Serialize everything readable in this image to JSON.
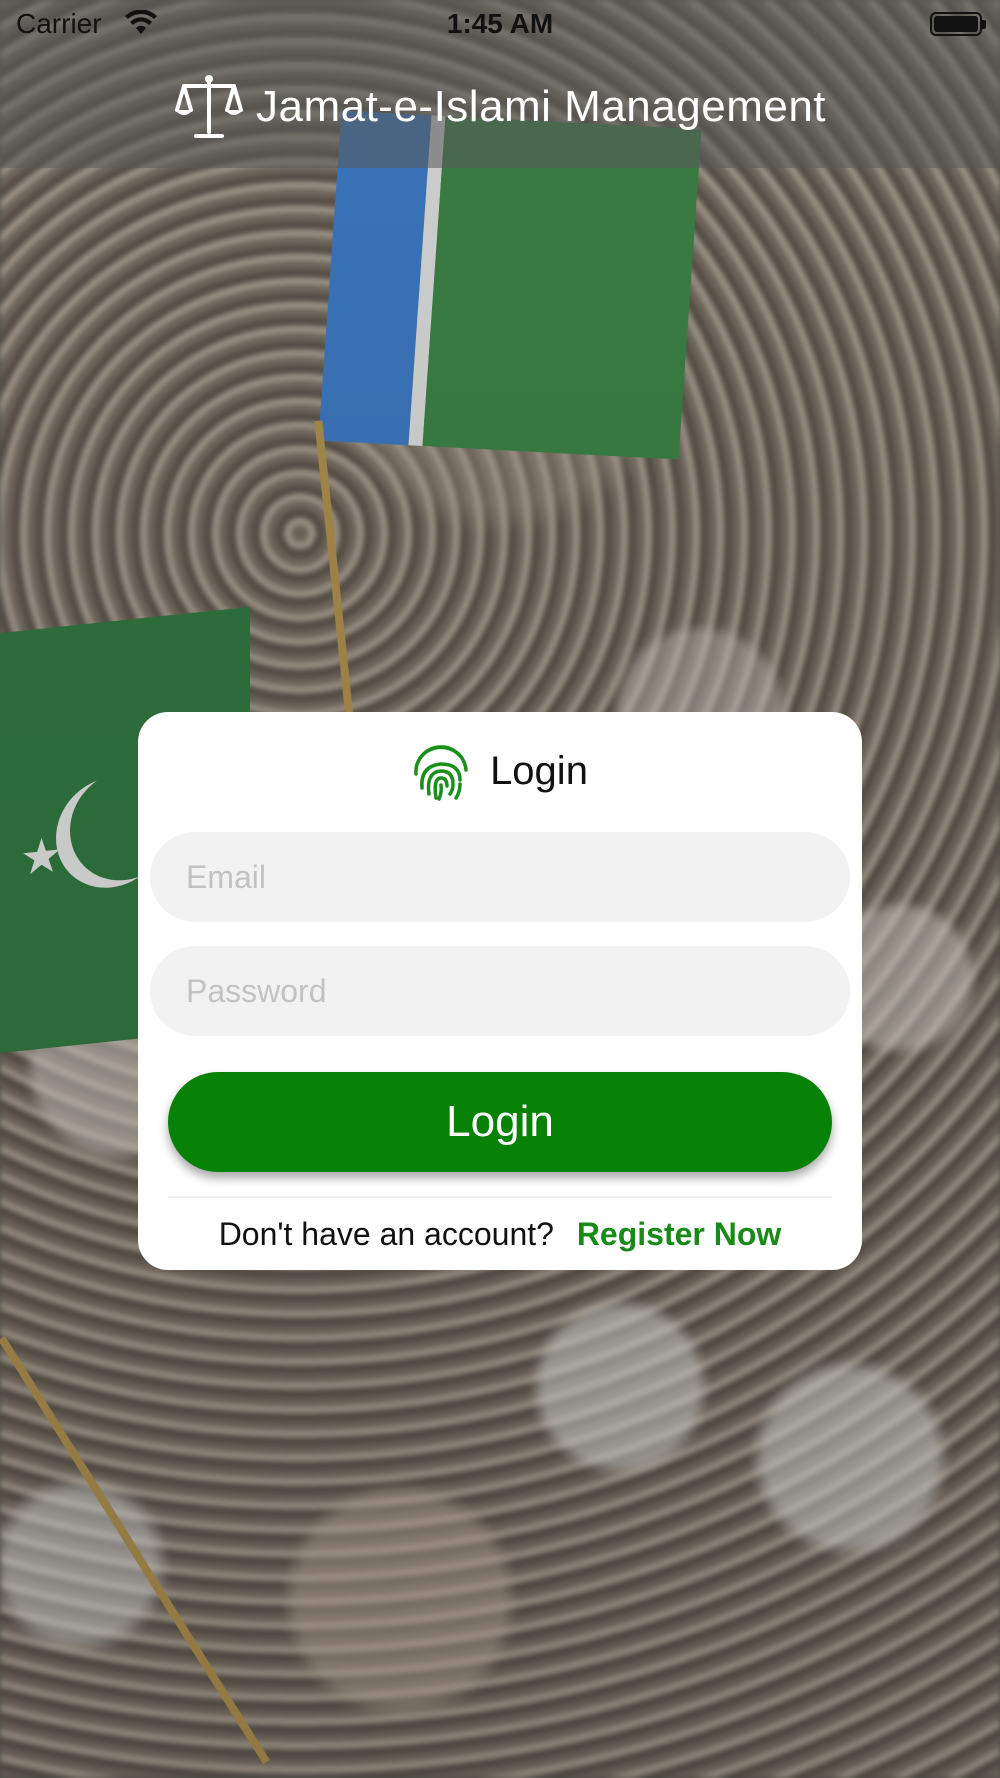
{
  "status_bar": {
    "carrier": "Carrier",
    "time": "1:45 AM"
  },
  "header": {
    "title": "Jamat-e-Islami Management",
    "logo_icon": "scales-of-justice-icon"
  },
  "login_card": {
    "title": "Login",
    "title_icon": "fingerprint-icon",
    "email_placeholder": "Email",
    "email_value": "",
    "password_placeholder": "Password",
    "password_value": "",
    "login_button_label": "Login",
    "register_prompt": "Don't have an account?",
    "register_link": "Register Now"
  },
  "colors": {
    "primary_green": "#078207",
    "link_green": "#188a18",
    "header_overlay": "rgba(90,90,90,0.55)",
    "field_background": "#f2f2f2"
  }
}
